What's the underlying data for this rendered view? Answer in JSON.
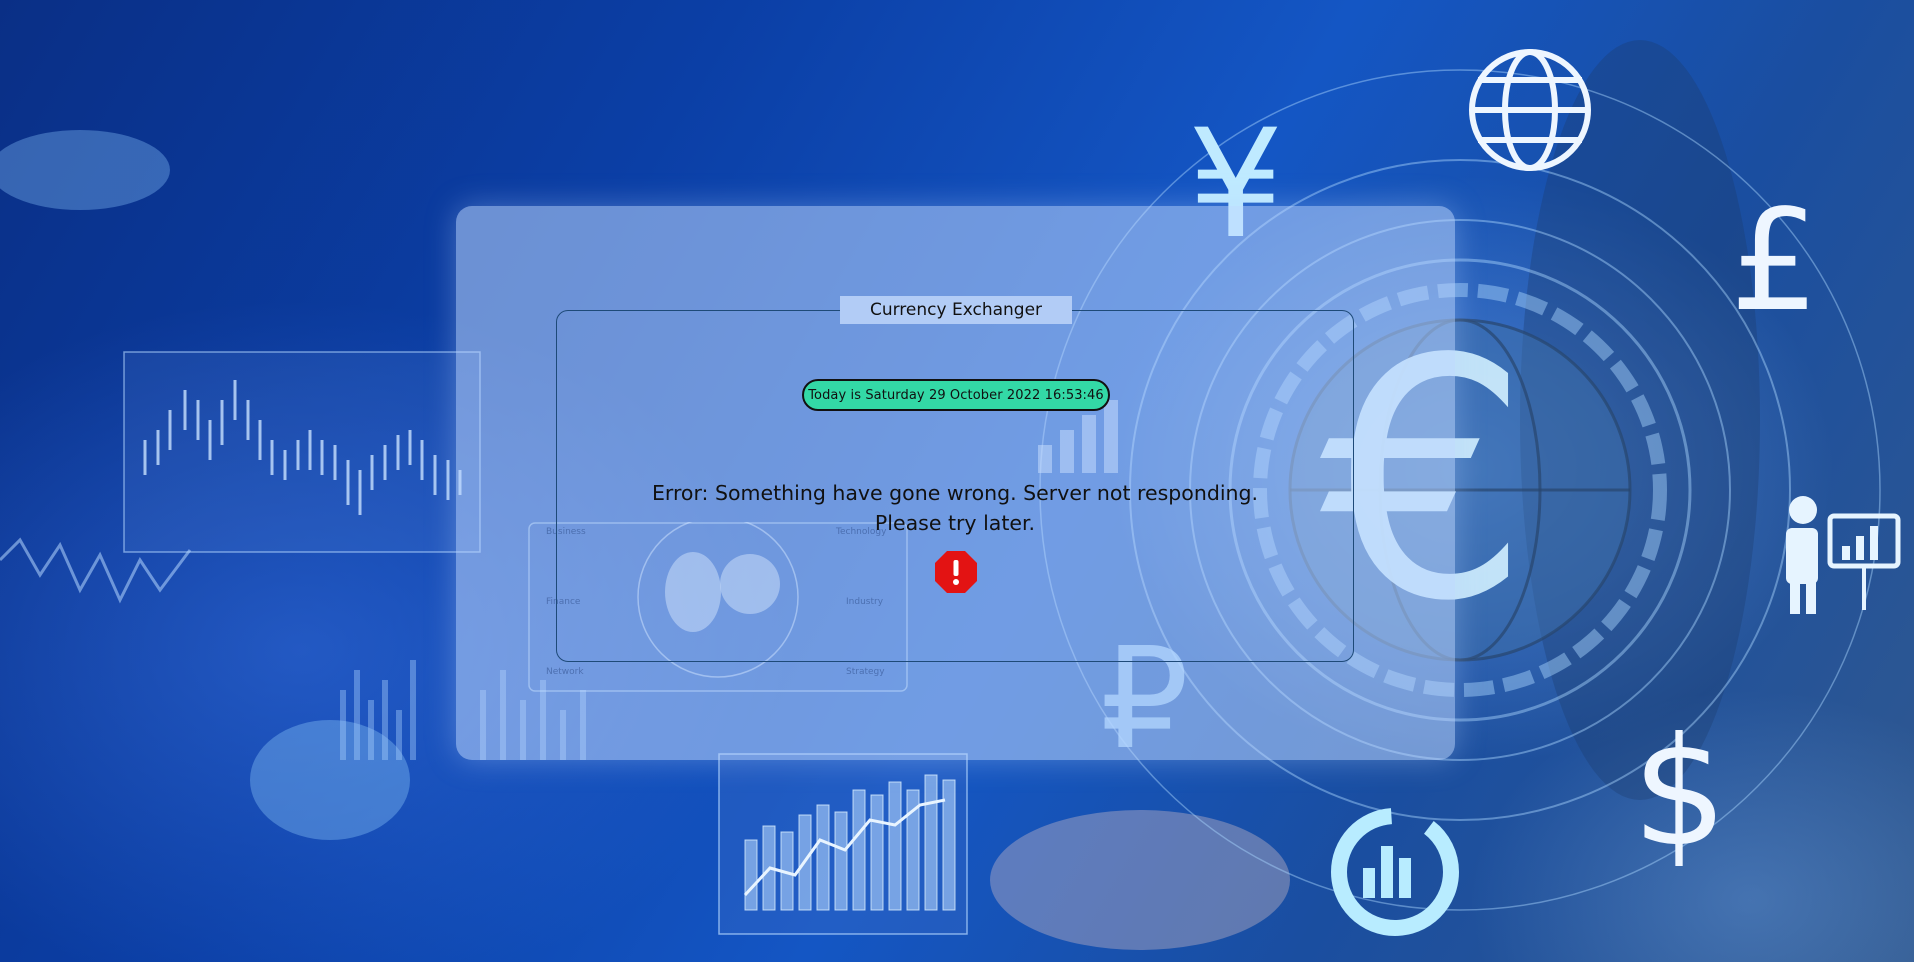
{
  "app": {
    "title": "Currency Exchanger",
    "date_label": "Today is Saturday 29 October 2022 16:53:46"
  },
  "error": {
    "line1": "Error: Something have gone wrong. Server not responding.",
    "line2": "Please try later.",
    "icon": "error-octagon-icon"
  },
  "background": {
    "currency_symbols": [
      "¥",
      "£",
      "€",
      "₽",
      "$"
    ],
    "chart_labels": [
      "Business",
      "Technology",
      "Finance",
      "Industry",
      "Network",
      "Strategy"
    ]
  },
  "colors": {
    "date_pill": "#33d9a6",
    "error_icon": "#e31313",
    "panel_border": "#1e4a78"
  }
}
